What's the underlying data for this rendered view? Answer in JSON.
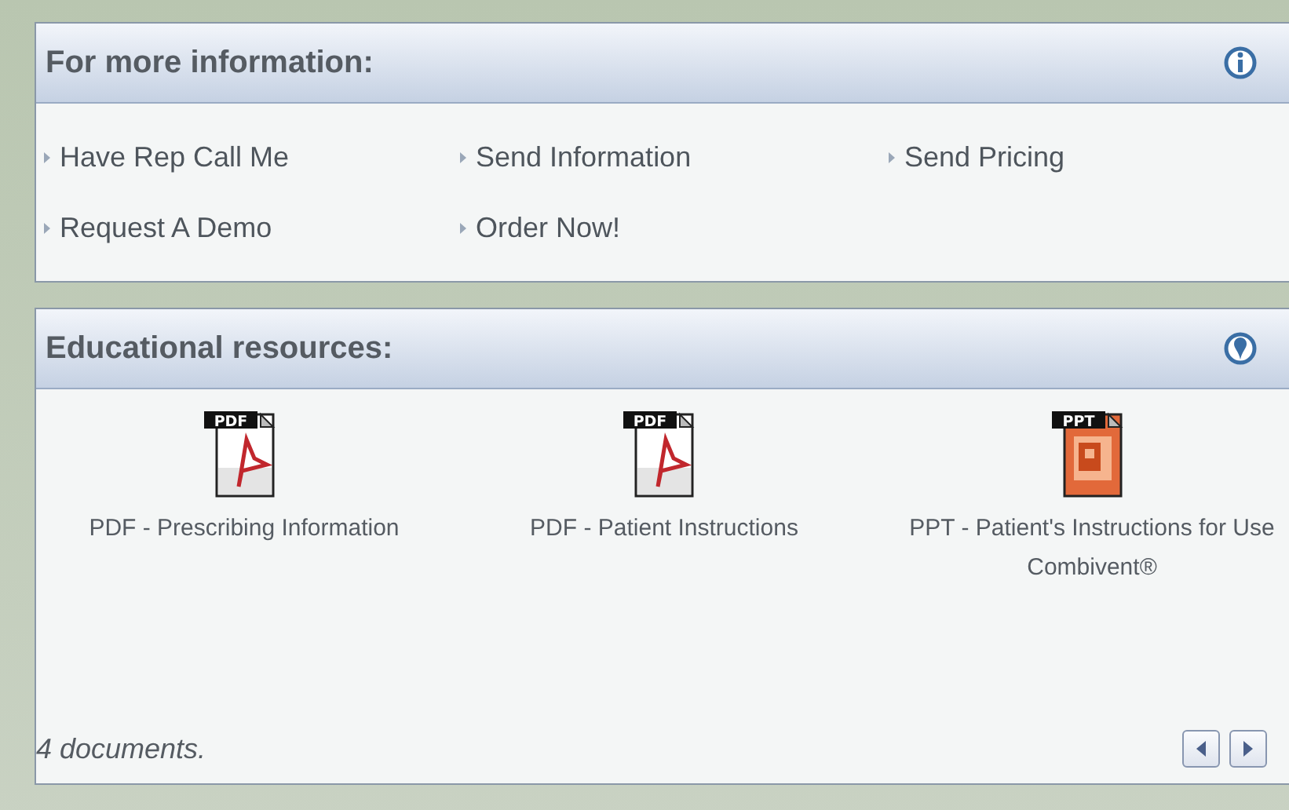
{
  "info_panel": {
    "title": "For more information:",
    "links": [
      {
        "label": "Have Rep Call Me"
      },
      {
        "label": "Send Information"
      },
      {
        "label": "Send Pricing"
      },
      {
        "label": "Request A Demo"
      },
      {
        "label": "Order Now!"
      }
    ]
  },
  "resources_panel": {
    "title": "Educational resources:",
    "documents": [
      {
        "kind": "pdf",
        "badge": "PDF",
        "label": "PDF - Prescribing Information"
      },
      {
        "kind": "pdf",
        "badge": "PDF",
        "label": "PDF - Patient Instructions"
      },
      {
        "kind": "ppt",
        "badge": "PPT",
        "label": "PPT - Patient's Instructions for Use Combivent®"
      }
    ],
    "count": "4 documents."
  }
}
